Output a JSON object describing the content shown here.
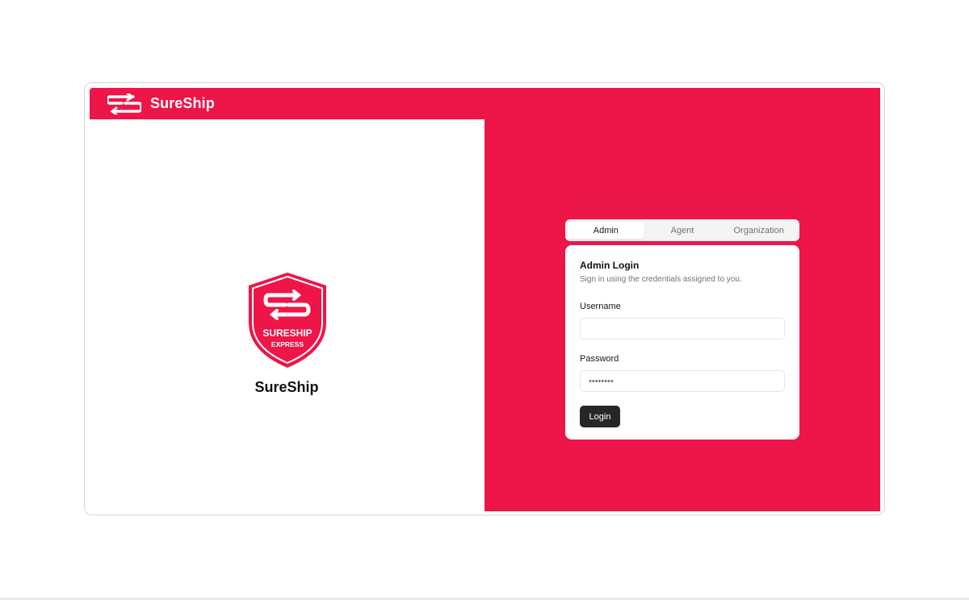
{
  "app": {
    "name": "SureShip",
    "logo_icon": "sureship-ss-logo-icon",
    "brand_color": "#ee1548"
  },
  "brand_panel": {
    "badge_icon": "sureship-express-shield-icon",
    "badge_text_top": "SURESHIP",
    "badge_text_bottom": "EXPRESS",
    "title": "SureShip"
  },
  "login": {
    "tabs": [
      {
        "label": "Admin",
        "active": true
      },
      {
        "label": "Agent",
        "active": false
      },
      {
        "label": "Organization",
        "active": false
      }
    ],
    "title": "Admin Login",
    "subtitle": "Sign in using the credentials assigned to you.",
    "username": {
      "label": "Username",
      "value": "",
      "placeholder": ""
    },
    "password": {
      "label": "Password",
      "placeholder": "••••••••"
    },
    "submit_label": "Login"
  }
}
